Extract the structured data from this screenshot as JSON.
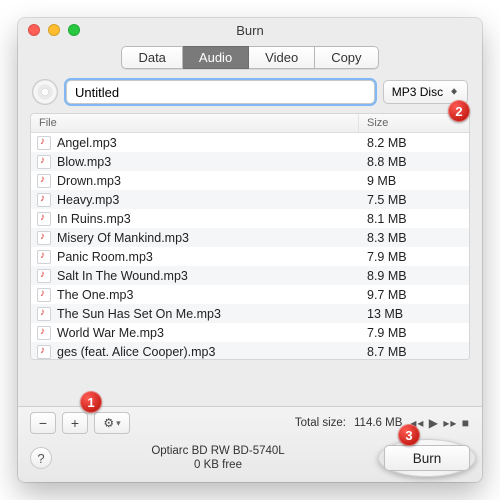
{
  "window": {
    "title": "Burn"
  },
  "tabs": {
    "data": "Data",
    "audio": "Audio",
    "video": "Video",
    "copy": "Copy",
    "selected": "audio"
  },
  "disc_name": {
    "value": "Untitled"
  },
  "type_button": {
    "label": "MP3 Disc"
  },
  "cols": {
    "file": "File",
    "size": "Size"
  },
  "files": [
    {
      "name": "Angel.mp3",
      "size": "8.2 MB"
    },
    {
      "name": "Blow.mp3",
      "size": "8.8 MB"
    },
    {
      "name": "Drown.mp3",
      "size": "9 MB"
    },
    {
      "name": "Heavy.mp3",
      "size": "7.5 MB"
    },
    {
      "name": "In Ruins.mp3",
      "size": "8.1 MB"
    },
    {
      "name": "Misery Of Mankind.mp3",
      "size": "8.3 MB"
    },
    {
      "name": "Panic Room.mp3",
      "size": "7.9 MB"
    },
    {
      "name": "Salt In The Wound.mp3",
      "size": "8.9 MB"
    },
    {
      "name": "The One.mp3",
      "size": "9.7 MB"
    },
    {
      "name": "The Sun Has Set On Me.mp3",
      "size": "13 MB"
    },
    {
      "name": "World War Me.mp3",
      "size": "7.9 MB"
    },
    {
      "name": "ges (feat. Alice Cooper).mp3",
      "size": "8.7 MB"
    }
  ],
  "toolbar": {
    "remove_glyph": "−",
    "add_glyph": "+",
    "total_label": "Total size:",
    "total_value": "114.6 MB"
  },
  "drive": {
    "name": "Optiarc BD RW BD-5740L",
    "free": "0 KB free"
  },
  "burn": {
    "label": "Burn"
  },
  "help": {
    "glyph": "?"
  },
  "callouts": {
    "c1": "1",
    "c2": "2",
    "c3": "3"
  }
}
